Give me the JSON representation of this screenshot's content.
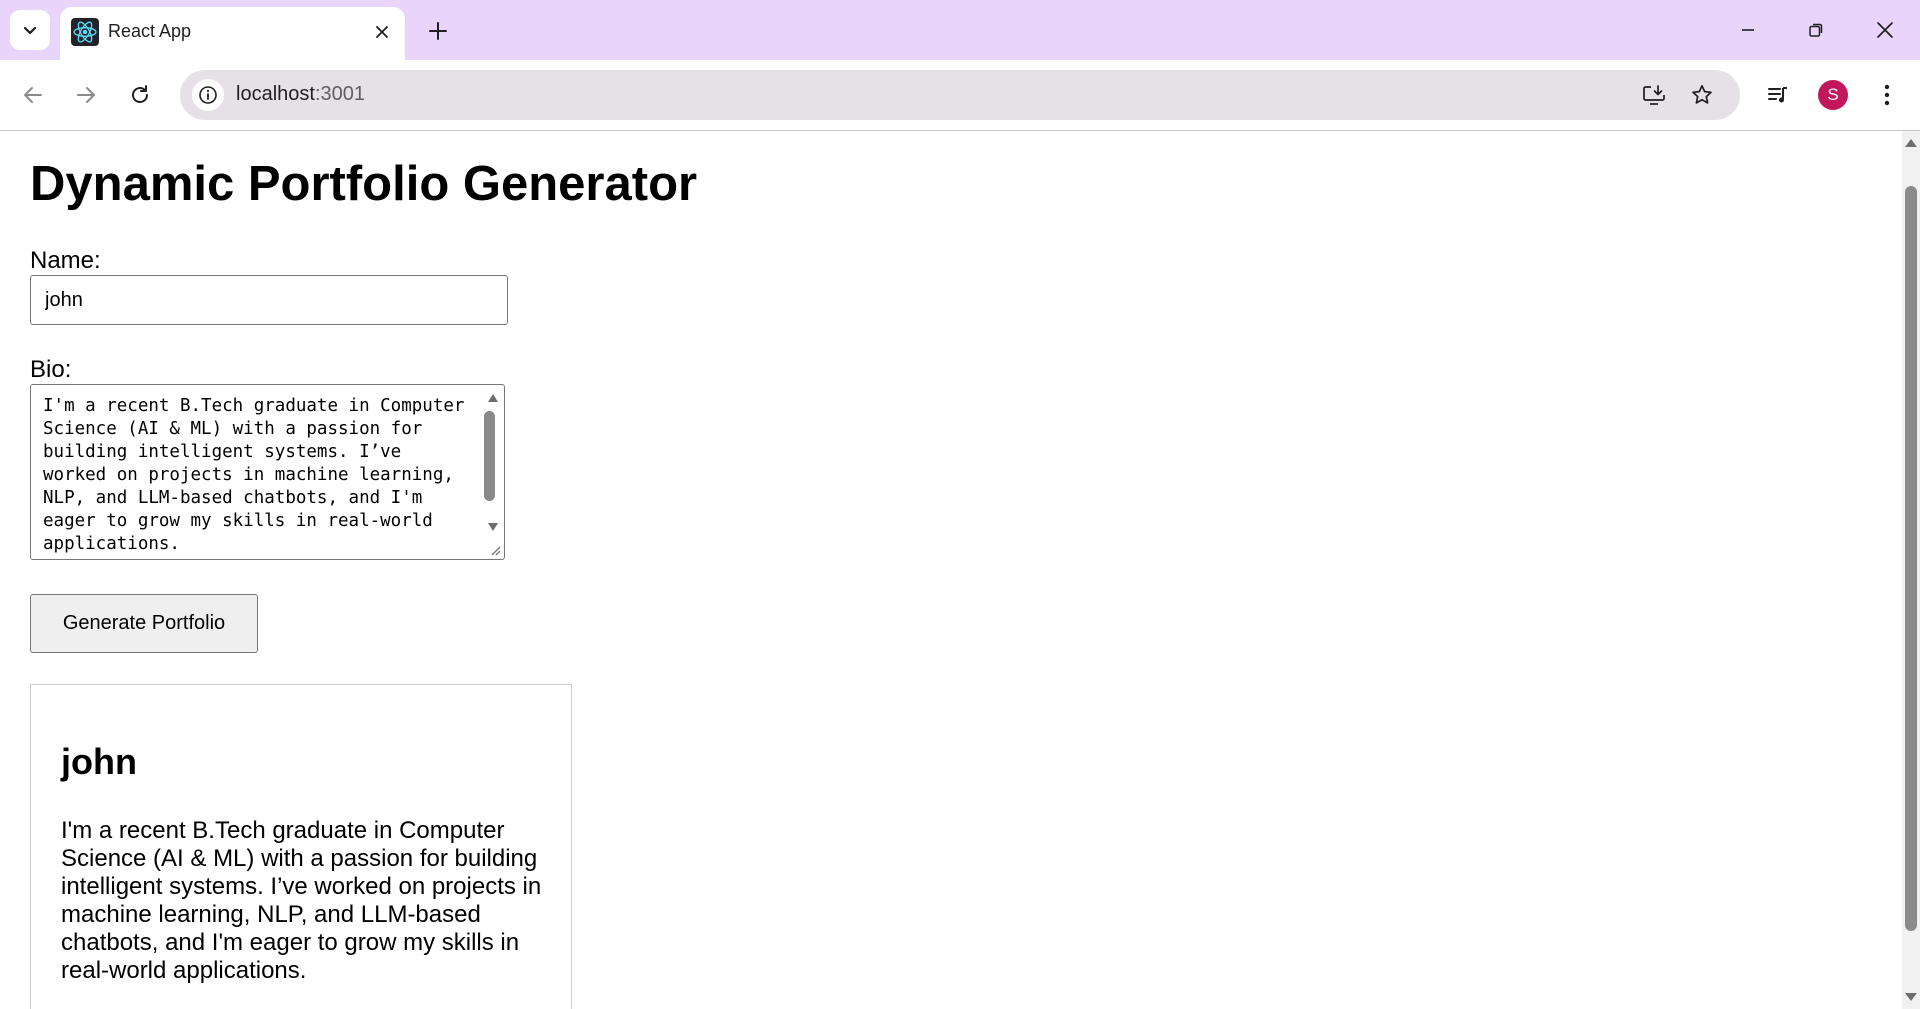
{
  "browser": {
    "tab": {
      "title": "React App"
    },
    "address": {
      "host": "localhost",
      "port": ":3001"
    },
    "profile_initial": "S",
    "icons": {
      "tab_search": "chevron-down-icon",
      "favicon": "react-logo-icon",
      "tab_close": "close-icon",
      "new_tab": "plus-icon",
      "minimize": "minimize-icon",
      "restore": "restore-icon",
      "close": "close-icon",
      "back": "arrow-left-icon",
      "forward": "arrow-right-icon",
      "reload": "reload-icon",
      "site_info": "info-icon",
      "install": "install-app-icon",
      "bookmark": "star-icon",
      "media": "media-controls-icon",
      "menu": "kebab-menu-icon"
    },
    "colors": {
      "tabstrip": "#e9d5fb",
      "avatar": "#c2185b"
    }
  },
  "page": {
    "title": "Dynamic Portfolio Generator",
    "form": {
      "name_label": "Name:",
      "name_value": "john",
      "bio_label": "Bio:",
      "bio_value": "I'm a recent B.Tech graduate in Computer Science (AI & ML) with a passion for building intelligent systems. I’ve worked on projects in machine learning, NLP, and LLM-based chatbots, and I'm eager to grow my skills in real-world applications.",
      "generate_label": "Generate Portfolio"
    },
    "portfolio": {
      "name": "john",
      "bio": "I'm a recent B.Tech graduate in Computer Science (AI & ML) with a passion for building intelligent systems. I’ve worked on projects in machine learning, NLP, and LLM-based chatbots, and I'm eager to grow my skills in real-world applications."
    }
  }
}
